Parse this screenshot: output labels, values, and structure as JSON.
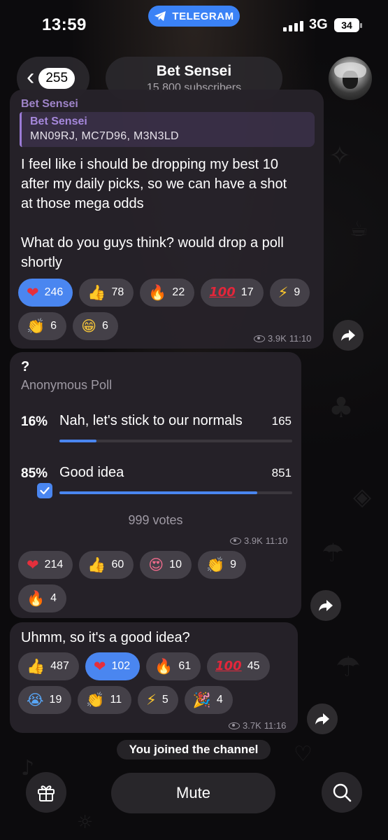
{
  "status_bar": {
    "time": "13:59",
    "app_pill": "TELEGRAM",
    "network": "3G",
    "battery": "34"
  },
  "header": {
    "unread_count": "255",
    "channel_name": "Bet Sensei",
    "subscribers": "15,800 subscribers"
  },
  "messages": [
    {
      "sender": "Bet Sensei",
      "quote": {
        "author": "Bet Sensei",
        "text": "MN09RJ, MC7D96, M3N3LD"
      },
      "text": "I feel like i should be dropping my best 10\nafter my daily picks, so we can have a shot\nat those mega odds\n\nWhat do you guys think? would drop a poll\nshortly",
      "reactions": [
        {
          "emoji": "heart",
          "count": "246",
          "active": true
        },
        {
          "emoji": "thumbs-up",
          "count": "78",
          "active": false
        },
        {
          "emoji": "fire",
          "count": "22",
          "active": false
        },
        {
          "emoji": "hundred",
          "count": "17",
          "active": false
        },
        {
          "emoji": "lightning",
          "count": "9",
          "active": false
        },
        {
          "emoji": "clap",
          "count": "6",
          "active": false
        },
        {
          "emoji": "grin",
          "count": "6",
          "active": false
        }
      ],
      "views": "3.9K",
      "time": "11:10"
    },
    {
      "poll": {
        "question": "?",
        "type": "Anonymous Poll",
        "options": [
          {
            "percent": "16%",
            "label": "Nah, let's stick to our normals",
            "votes": "165",
            "fraction": 0.16,
            "selected": false
          },
          {
            "percent": "85%",
            "label": "Good idea",
            "votes": "851",
            "fraction": 0.85,
            "selected": true
          }
        ],
        "total": "999 votes"
      },
      "reactions": [
        {
          "emoji": "heart",
          "count": "214",
          "active": false
        },
        {
          "emoji": "thumbs-up",
          "count": "60",
          "active": false
        },
        {
          "emoji": "smiling-hearts",
          "count": "10",
          "active": false
        },
        {
          "emoji": "clap",
          "count": "9",
          "active": false
        },
        {
          "emoji": "fire",
          "count": "4",
          "active": false
        }
      ],
      "views": "3.9K",
      "time": "11:10"
    },
    {
      "text": "Uhmm, so it's a good idea?",
      "reactions": [
        {
          "emoji": "thumbs-up",
          "count": "487",
          "active": false
        },
        {
          "emoji": "heart",
          "count": "102",
          "active": true
        },
        {
          "emoji": "fire",
          "count": "61",
          "active": false
        },
        {
          "emoji": "hundred",
          "count": "45",
          "active": false
        },
        {
          "emoji": "crying",
          "count": "19",
          "active": false
        },
        {
          "emoji": "clap",
          "count": "11",
          "active": false
        },
        {
          "emoji": "lightning",
          "count": "5",
          "active": false
        },
        {
          "emoji": "party",
          "count": "4",
          "active": false
        }
      ],
      "views": "3.7K",
      "time": "11:16"
    }
  ],
  "service_message": "You joined the channel",
  "bottom_bar": {
    "gift_icon": "gift-icon",
    "mute_label": "Mute",
    "search_icon": "search-icon"
  },
  "colors": {
    "accent": "#4a86f0",
    "quote_accent": "#9b7bd6",
    "telegram_pill": "#3b82f6",
    "bubble": "#26222a"
  }
}
